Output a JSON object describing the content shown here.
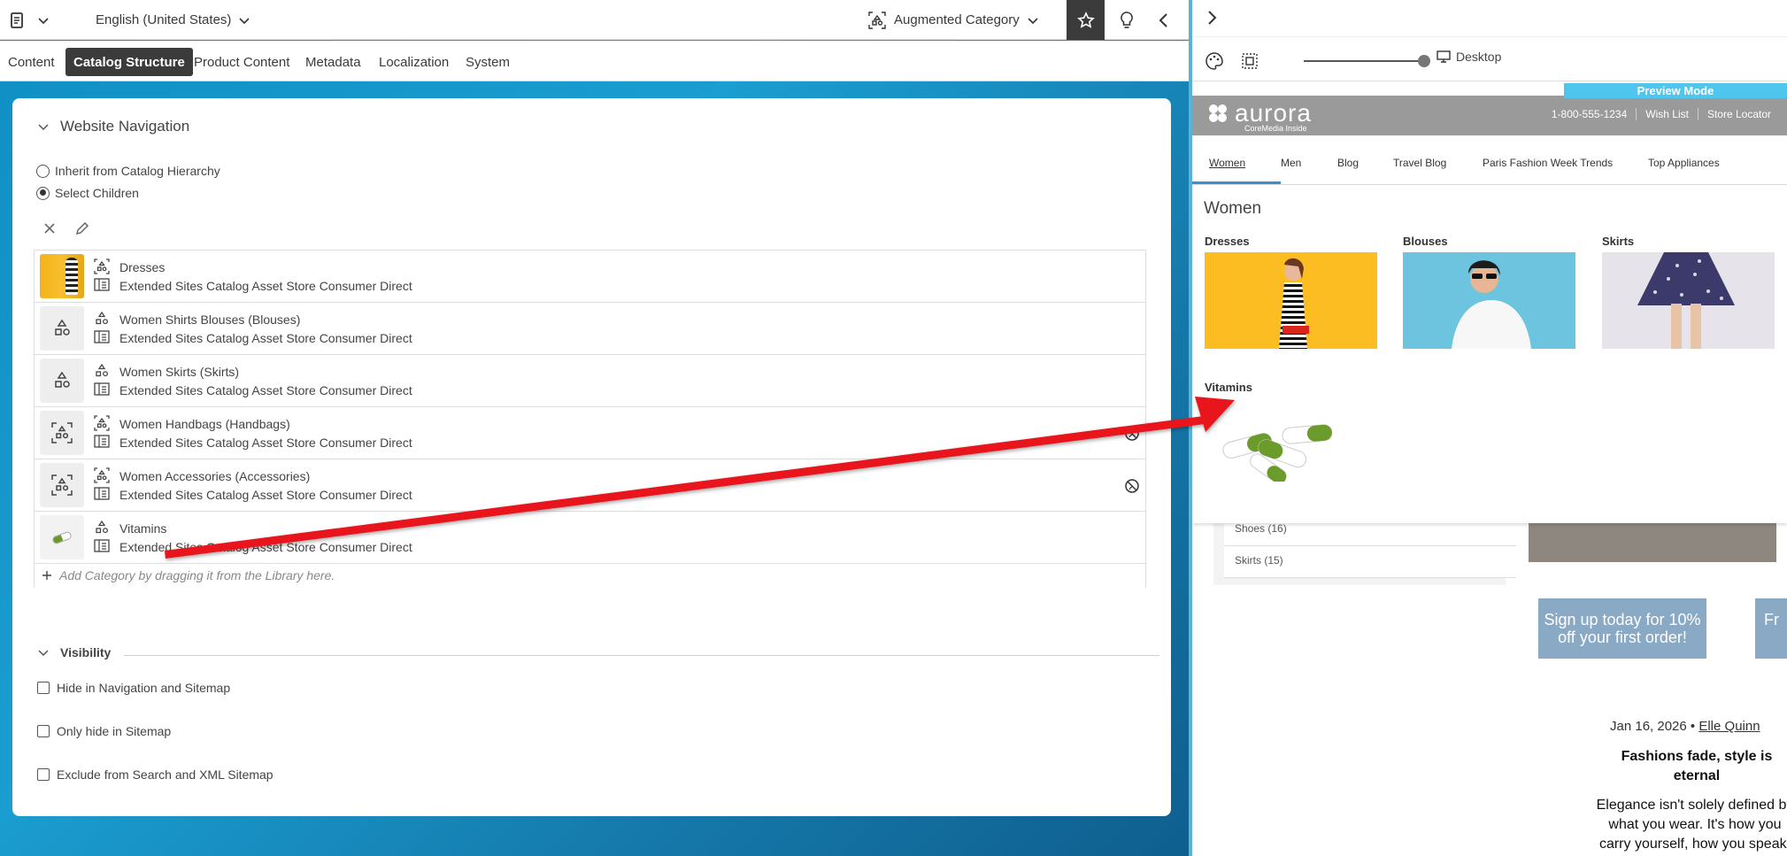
{
  "topbar": {
    "language": "English (United States)",
    "content_type": "Augmented Category"
  },
  "tabs": [
    {
      "label": "Content"
    },
    {
      "label": "Catalog Structure"
    },
    {
      "label": "Product Content"
    },
    {
      "label": "Metadata"
    },
    {
      "label": "Localization"
    },
    {
      "label": "System"
    }
  ],
  "navigation": {
    "title": "Website Navigation",
    "radio_inherit": "Inherit from Catalog Hierarchy",
    "radio_select": "Select Children",
    "children": [
      {
        "name": "Dresses",
        "catalog": "Extended Sites Catalog Asset Store Consumer Direct"
      },
      {
        "name": "Women Shirts Blouses (Blouses)",
        "catalog": "Extended Sites Catalog Asset Store Consumer Direct"
      },
      {
        "name": "Women Skirts (Skirts)",
        "catalog": "Extended Sites Catalog Asset Store Consumer Direct"
      },
      {
        "name": "Women Handbags (Handbags)",
        "catalog": "Extended Sites Catalog Asset Store Consumer Direct"
      },
      {
        "name": "Women Accessories (Accessories)",
        "catalog": "Extended Sites Catalog Asset Store Consumer Direct"
      },
      {
        "name": "Vitamins",
        "catalog": "Extended Sites Catalog Asset Store Consumer Direct"
      }
    ],
    "add_hint": "Add Category by dragging it from the Library here."
  },
  "visibility": {
    "title": "Visibility",
    "hide_nav": "Hide in Navigation and Sitemap",
    "hide_sitemap": "Only hide in Sitemap",
    "exclude_search": "Exclude from Search and XML Sitemap"
  },
  "preview": {
    "device": "Desktop",
    "mode_label": "Preview Mode",
    "logo_word": "aurora",
    "logo_tag": "CoreMedia Inside",
    "phone": "1-800-555-1234",
    "wish_list": "Wish List",
    "store_locator": "Store Locator",
    "nav": [
      "Women",
      "Men",
      "Blog",
      "Travel Blog",
      "Paris Fashion Week Trends",
      "Top Appliances"
    ],
    "menu_title": "Women",
    "categories": [
      "Dresses",
      "Blouses",
      "Skirts",
      "Vitamins"
    ],
    "bg_items": [
      "Shoes (16)",
      "Skirts (15)"
    ],
    "promo1": "Sign up today for 10% off your first order!",
    "promo2": "Fr",
    "blog_date": "Jan 16, 2026",
    "blog_author": "Elle Quinn",
    "blog_title": "Fashions fade, style is eternal",
    "blog_text": "Elegance isn't solely defined by what you wear. It's how you carry yourself, how you speak,"
  },
  "colors": {
    "studio_bg": "#1a9dd0",
    "active_tab": "#3b3b3b",
    "preview_mode": "#4ec6ee",
    "site_header": "#9a9a9a",
    "arrow": "#e8151b"
  }
}
